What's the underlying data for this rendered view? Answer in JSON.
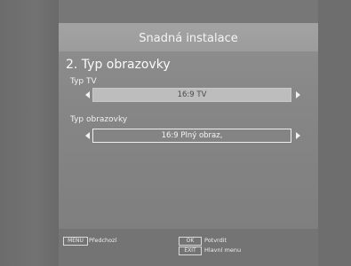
{
  "header": {
    "title": "Snadná instalace"
  },
  "section": {
    "title": "2. Typ obrazovky"
  },
  "fields": [
    {
      "label": "Typ TV",
      "value": "16:9 TV"
    },
    {
      "label": "Typ obrazovky",
      "value": "16:9 Plný obraz,"
    }
  ],
  "footer": {
    "menu_key": "MENU",
    "menu_hint": "Předchozí",
    "ok_key": "OK",
    "ok_hint": "Potvrdit",
    "exit_key": "EXIT",
    "exit_hint": "Hlavní menu"
  },
  "colors": {
    "background": "#6e6e6e",
    "header_bar": "#a0a0a0",
    "active_field": "#bdbdbd"
  }
}
